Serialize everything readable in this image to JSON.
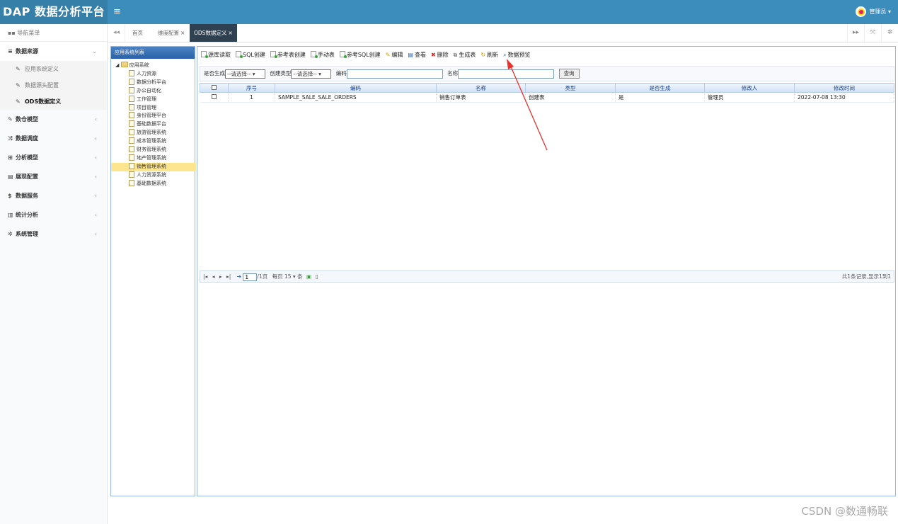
{
  "header": {
    "brand": "DAP 数据分析平台",
    "menu_toggle": "≡",
    "user": "管理员 ▾"
  },
  "sidebar": {
    "nav_title": "导航菜单",
    "menus": [
      {
        "icon": "≡",
        "label": "数据来源",
        "arrow": "⌄",
        "open": true
      },
      {
        "icon": "✎",
        "label": "数仓模型",
        "arrow": "‹"
      },
      {
        "icon": "⤨",
        "label": "数据调度",
        "arrow": "‹"
      },
      {
        "icon": "⊞",
        "label": "分析模型",
        "arrow": "‹"
      },
      {
        "icon": "▤",
        "label": "展现配置",
        "arrow": "‹"
      },
      {
        "icon": "$",
        "label": "数据服务",
        "arrow": "‹"
      },
      {
        "icon": "▥",
        "label": "统计分析",
        "arrow": "‹"
      },
      {
        "icon": "✲",
        "label": "系统管理",
        "arrow": "‹"
      }
    ],
    "sub_items": [
      {
        "label": "应用系统定义"
      },
      {
        "label": "数据源头配置"
      },
      {
        "label": "ODS数据定义",
        "active": true
      }
    ]
  },
  "tabs": {
    "back": "◂◂",
    "home": "首页",
    "tab1": "维度配置",
    "tab2": "ODS数据定义",
    "close": "×",
    "forward": "▸▸",
    "fullscreen": "⤧",
    "settings": "✲"
  },
  "tree": {
    "title": "应用系统列表",
    "root": "应用系统",
    "items": [
      "人力资源",
      "数据分析平台",
      "办公自动化",
      "工作管理",
      "项目管理",
      "身份管理平台",
      "基础数据平台",
      "旅游管理系统",
      "成本管理系统",
      "财务管理系统",
      "地产管理系统",
      "销售管理系统",
      "人力资源系统",
      "基础数据系统"
    ],
    "selected": "销售管理系统"
  },
  "toolbar": [
    "源库读取",
    "SQL创建",
    "参考表创建",
    "手动表",
    "参考SQL创建",
    "编辑",
    "查看",
    "删除",
    "生成表",
    "刷新",
    "数据预览"
  ],
  "filter": {
    "generated_label": "是否生成",
    "generated_value": "--请选择-- ▾",
    "create_type_label": "创建类型",
    "create_type_value": "--请选择-- ▾",
    "code_label": "编码",
    "name_label": "名称",
    "query_button": "查询"
  },
  "table": {
    "columns": [
      "序号",
      "编码",
      "名称",
      "类型",
      "是否生成",
      "修改人",
      "修改时间"
    ],
    "rows": [
      [
        "1",
        "SAMPLE_SALE_SALE_ORDERS",
        "销售订单表",
        "创建表",
        "是",
        "管理员",
        "2022-07-08 13:30"
      ]
    ]
  },
  "pager": {
    "first": "|◂",
    "prev": "◂",
    "next": "▸",
    "last": "▸|",
    "go": "➔",
    "page": "1",
    "total_pages": "/1页",
    "per_page_label": "每页",
    "per_page": "15 ▾",
    "unit": "条",
    "summary": "共1条记录,显示1到1"
  },
  "watermark": "CSDN @数通畅联",
  "colors": {
    "header": "#3c8dbc",
    "brand": "#367fa9",
    "active_tab": "#2f4050",
    "arrow": "#e8322b"
  }
}
